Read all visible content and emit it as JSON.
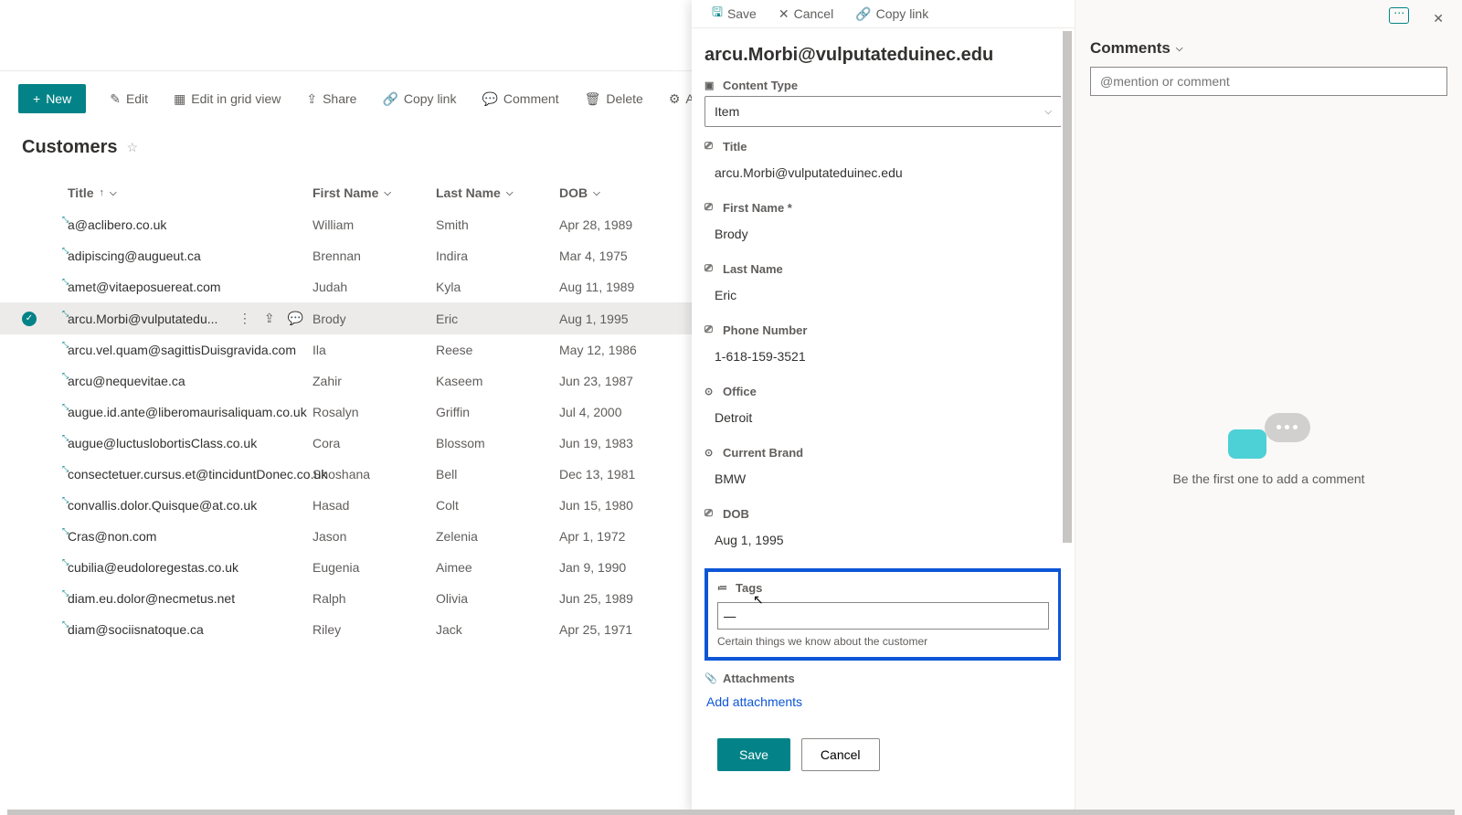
{
  "commandBar": {
    "new": "New",
    "edit": "Edit",
    "editGrid": "Edit in grid view",
    "share": "Share",
    "copyLink": "Copy link",
    "comment": "Comment",
    "delete": "Delete",
    "automate": "Automate"
  },
  "listTitle": "Customers",
  "columns": {
    "title": "Title",
    "firstName": "First Name",
    "lastName": "Last Name",
    "dob": "DOB"
  },
  "rows": [
    {
      "title": "a@aclibero.co.uk",
      "firstName": "William",
      "lastName": "Smith",
      "dob": "Apr 28, 1989",
      "selected": false
    },
    {
      "title": "adipiscing@augueut.ca",
      "firstName": "Brennan",
      "lastName": "Indira",
      "dob": "Mar 4, 1975",
      "selected": false
    },
    {
      "title": "amet@vitaeposuereat.com",
      "firstName": "Judah",
      "lastName": "Kyla",
      "dob": "Aug 11, 1989",
      "selected": false
    },
    {
      "title": "arcu.Morbi@vulputatedu...",
      "firstName": "Brody",
      "lastName": "Eric",
      "dob": "Aug 1, 1995",
      "selected": true
    },
    {
      "title": "arcu.vel.quam@sagittisDuisgravida.com",
      "firstName": "Ila",
      "lastName": "Reese",
      "dob": "May 12, 1986",
      "selected": false
    },
    {
      "title": "arcu@nequevitae.ca",
      "firstName": "Zahir",
      "lastName": "Kaseem",
      "dob": "Jun 23, 1987",
      "selected": false
    },
    {
      "title": "augue.id.ante@liberomaurisaliquam.co.uk",
      "firstName": "Rosalyn",
      "lastName": "Griffin",
      "dob": "Jul 4, 2000",
      "selected": false
    },
    {
      "title": "augue@luctuslobortisClass.co.uk",
      "firstName": "Cora",
      "lastName": "Blossom",
      "dob": "Jun 19, 1983",
      "selected": false
    },
    {
      "title": "consectetuer.cursus.et@tinciduntDonec.co.uk",
      "firstName": "Shoshana",
      "lastName": "Bell",
      "dob": "Dec 13, 1981",
      "selected": false
    },
    {
      "title": "convallis.dolor.Quisque@at.co.uk",
      "firstName": "Hasad",
      "lastName": "Colt",
      "dob": "Jun 15, 1980",
      "selected": false
    },
    {
      "title": "Cras@non.com",
      "firstName": "Jason",
      "lastName": "Zelenia",
      "dob": "Apr 1, 1972",
      "selected": false
    },
    {
      "title": "cubilia@eudoloregestas.co.uk",
      "firstName": "Eugenia",
      "lastName": "Aimee",
      "dob": "Jan 9, 1990",
      "selected": false
    },
    {
      "title": "diam.eu.dolor@necmetus.net",
      "firstName": "Ralph",
      "lastName": "Olivia",
      "dob": "Jun 25, 1989",
      "selected": false
    },
    {
      "title": "diam@sociisnatoque.ca",
      "firstName": "Riley",
      "lastName": "Jack",
      "dob": "Apr 25, 1971",
      "selected": false
    }
  ],
  "panel": {
    "toolbar": {
      "save": "Save",
      "cancel": "Cancel",
      "copyLink": "Copy link"
    },
    "heading": "arcu.Morbi@vulputateduinec.edu",
    "fields": {
      "contentTypeLabel": "Content Type",
      "contentTypeValue": "Item",
      "titleLabel": "Title",
      "titleValue": "arcu.Morbi@vulputateduinec.edu",
      "firstNameLabel": "First Name *",
      "firstNameValue": "Brody",
      "lastNameLabel": "Last Name",
      "lastNameValue": "Eric",
      "phoneLabel": "Phone Number",
      "phoneValue": "1-618-159-3521",
      "officeLabel": "Office",
      "officeValue": "Detroit",
      "brandLabel": "Current Brand",
      "brandValue": "BMW",
      "dobLabel": "DOB",
      "dobValue": "Aug 1, 1995",
      "tagsLabel": "Tags",
      "tagsValue": "—",
      "tagsDesc": "Certain things we know about the customer",
      "attachmentsLabel": "Attachments",
      "addAttachments": "Add attachments"
    },
    "footer": {
      "save": "Save",
      "cancel": "Cancel"
    }
  },
  "comments": {
    "header": "Comments",
    "placeholder": "@mention or comment",
    "empty": "Be the first one to add a comment"
  }
}
